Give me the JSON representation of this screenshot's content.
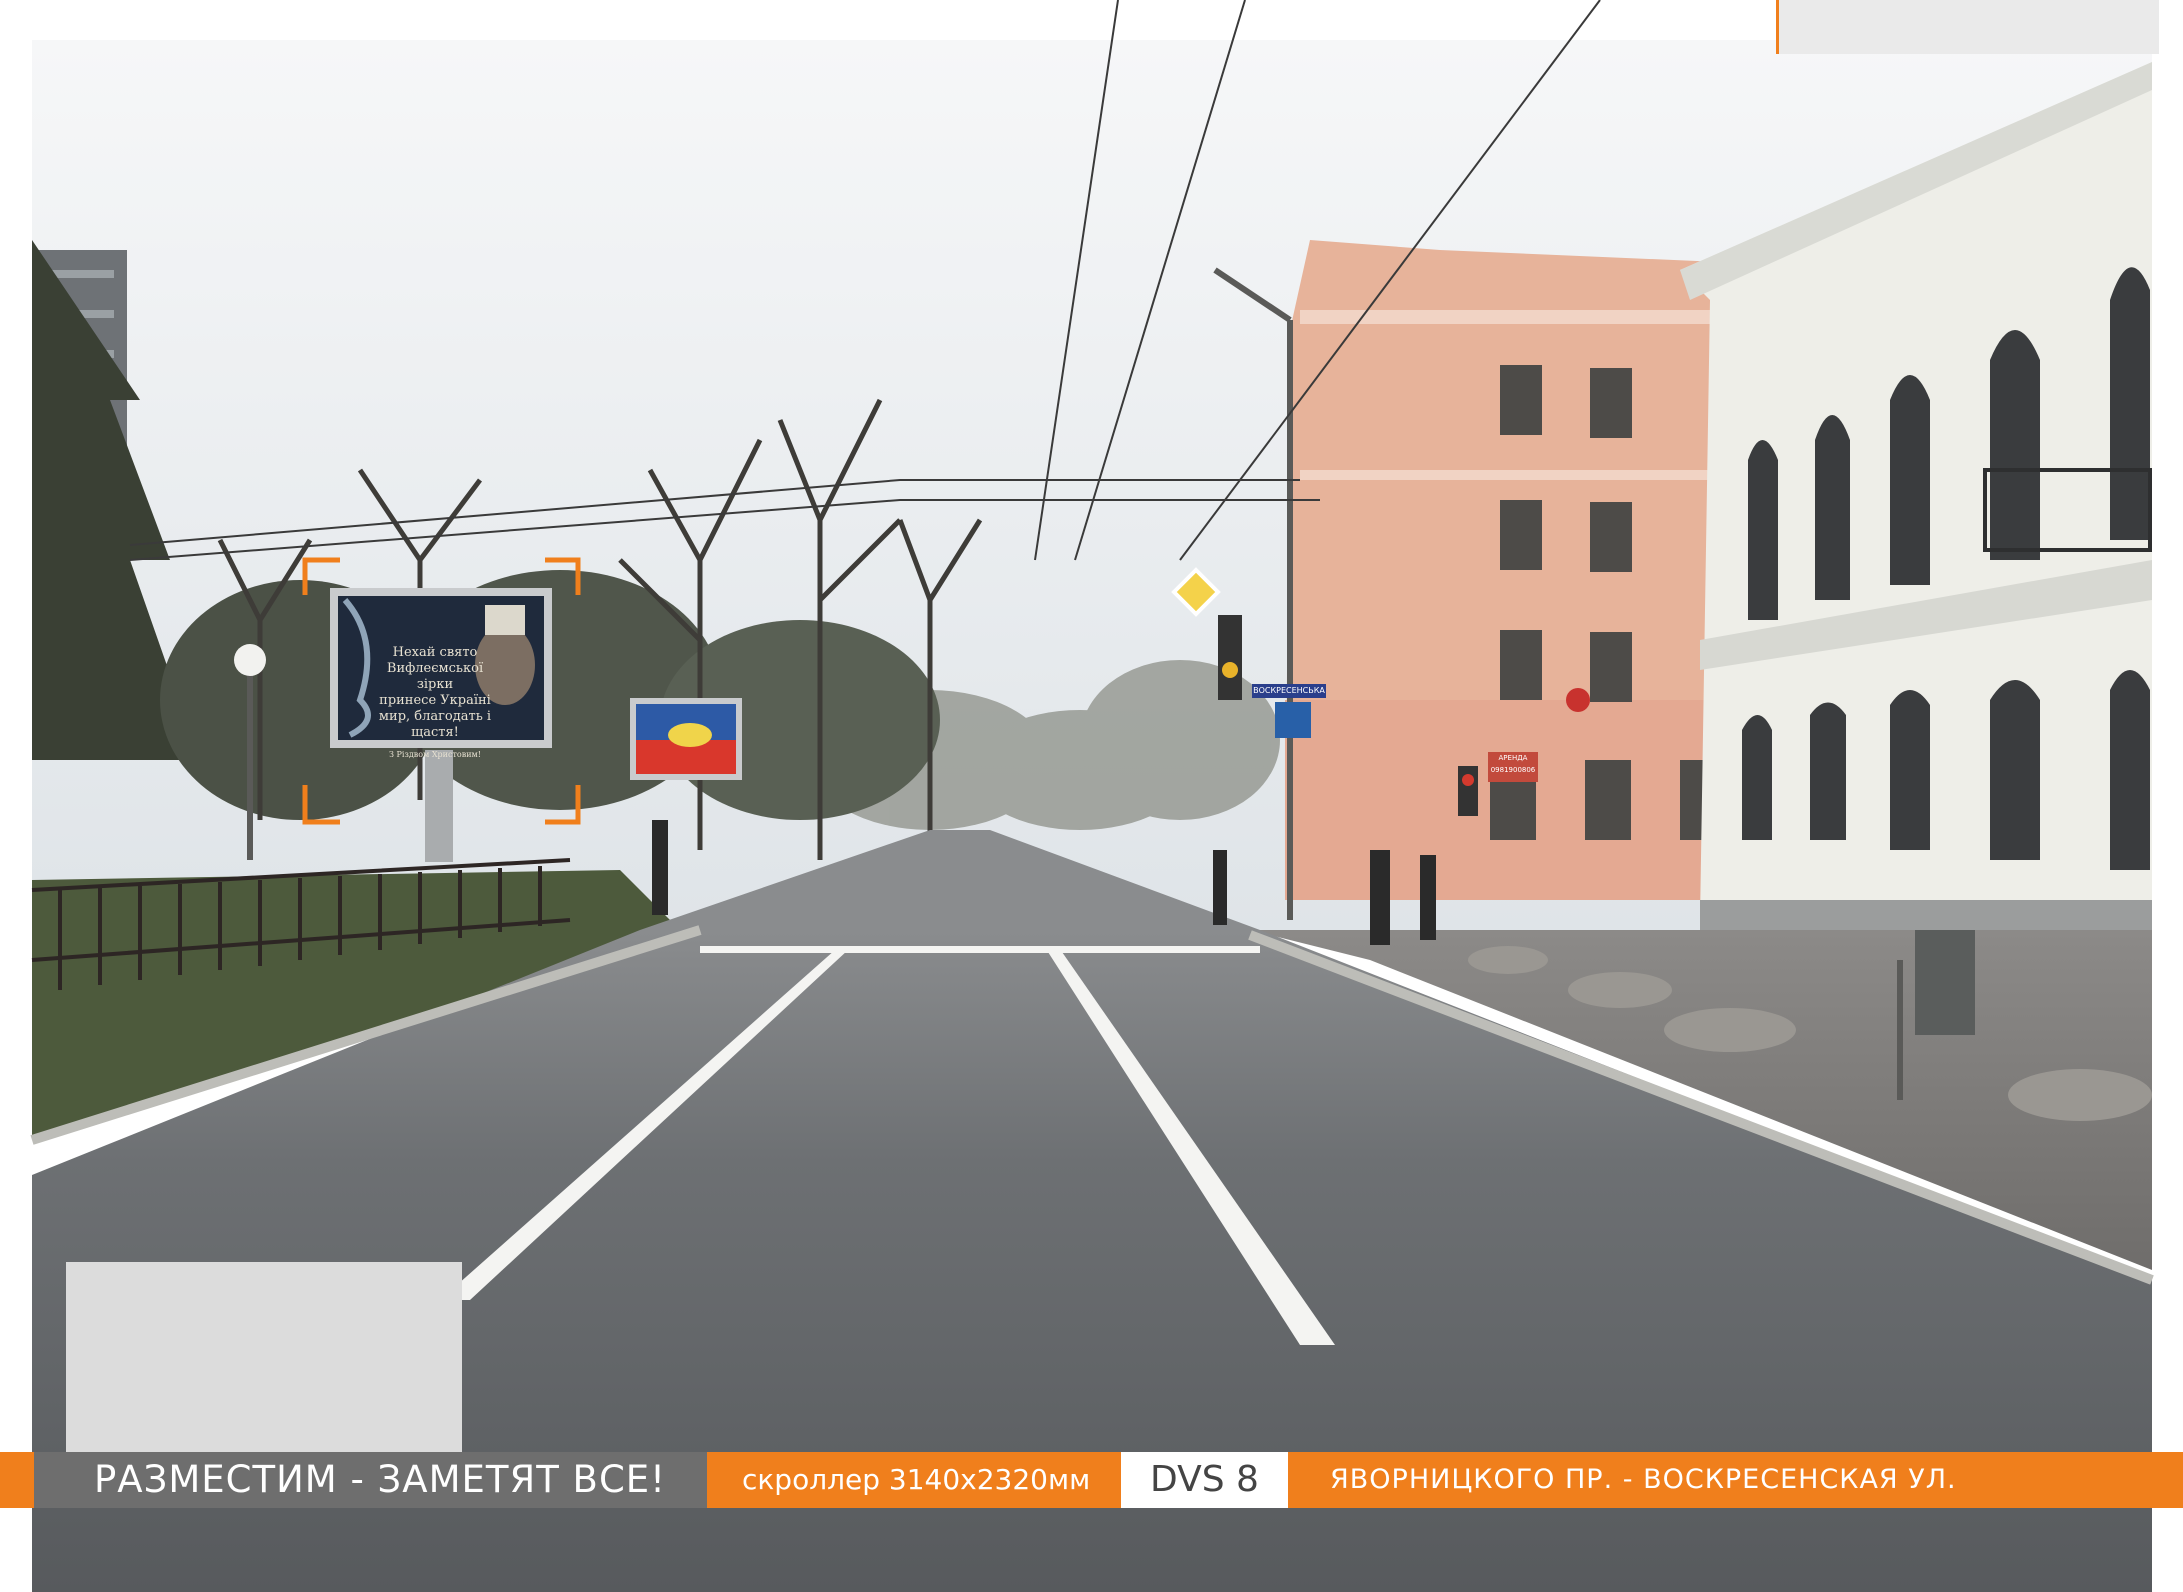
{
  "footer": {
    "slogan": "РАЗМЕСТИМ - ЗАМЕТЯТ ВСЕ!",
    "format": "скроллер  3140x2320мм",
    "code": "DVS 8",
    "address": "ЯВОРНИЦКОГО ПР. - ВОСКРЕСЕНСКАЯ УЛ."
  },
  "billboard": {
    "line1": "Нехай свято",
    "line2": "Вифлеємської зірки",
    "line3": "принесе Україні",
    "line4": "мир, благодать і щастя!",
    "small": "З Різдвом Христовим!"
  },
  "signs": {
    "street_name": "ВОСКРЕСЕНСЬКА",
    "shop_sign_1": "АРЕНДА",
    "shop_sign_2": "0981900806"
  },
  "colors": {
    "accent_orange": "#f07f1c",
    "slogan_gray": "#6e6e6e",
    "sky": "#e9edf0",
    "asphalt": "#5d6063",
    "facade_pink": "#e8b59c",
    "facade_white": "#eeeee8"
  }
}
